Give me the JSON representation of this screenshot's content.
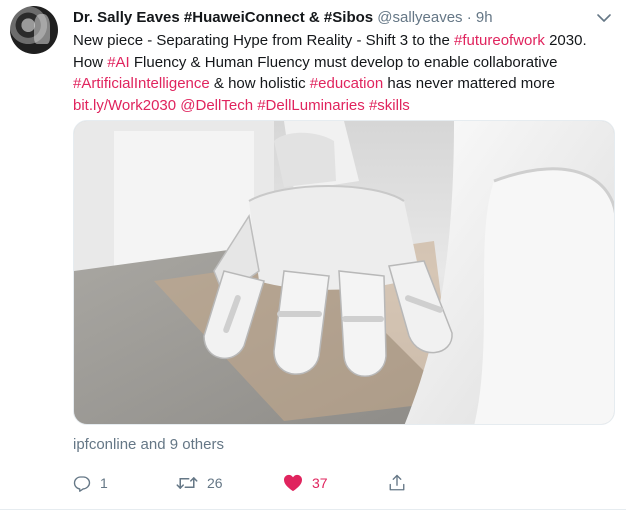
{
  "tweet": {
    "author_name": "Dr. Sally Eaves #HuaweiConnect & #Sibos",
    "handle": "@sallyeaves",
    "separator": "·",
    "time": "9h",
    "text_segments": [
      {
        "text": "New piece - Separating Hype from Reality - Shift 3 to the ",
        "link": false
      },
      {
        "text": "#futureofwork",
        "link": true
      },
      {
        "text": " 2030. How ",
        "link": false
      },
      {
        "text": "#AI",
        "link": true
      },
      {
        "text": " Fluency & Human Fluency must develop to enable collaborative ",
        "link": false
      },
      {
        "text": "#ArtificialIntelligence",
        "link": true
      },
      {
        "text": " & how holistic ",
        "link": false
      },
      {
        "text": "#education",
        "link": true
      },
      {
        "text": " has never mattered more ",
        "link": false
      },
      {
        "text": "bit.ly/Work2030",
        "link": true
      },
      {
        "text": " ",
        "link": false
      },
      {
        "text": "@DellTech",
        "link": true
      },
      {
        "text": " ",
        "link": false
      },
      {
        "text": "#DellLuminaries",
        "link": true
      },
      {
        "text": " ",
        "link": false
      },
      {
        "text": "#skills",
        "link": true
      }
    ],
    "liked_by": "ipfconline and 9 others",
    "actions": {
      "reply_count": "1",
      "retweet_count": "26",
      "like_count": "37"
    }
  },
  "colors": {
    "link": "#e0245e",
    "muted": "#657786",
    "like": "#e0245e"
  },
  "icons": [
    "caret-down-icon",
    "reply-icon",
    "retweet-icon",
    "heart-icon",
    "share-icon"
  ]
}
